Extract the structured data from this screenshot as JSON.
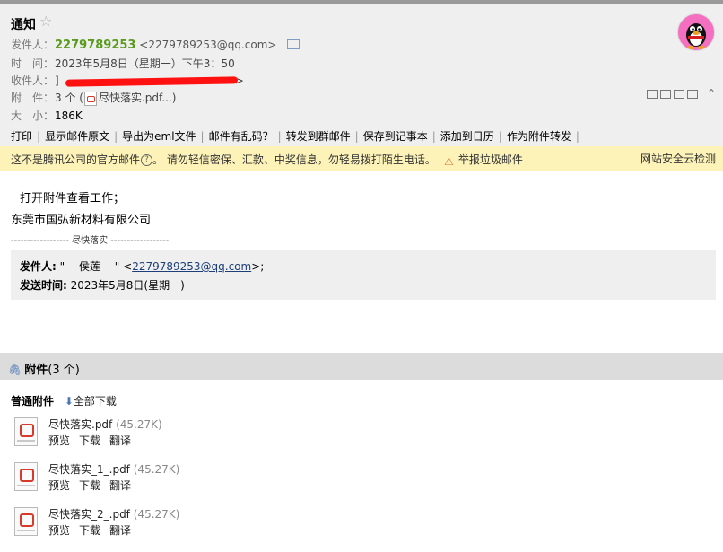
{
  "header": {
    "subject": "通知",
    "from_label": "发件人：",
    "from_name": "2279789253",
    "from_addr": "<2279789253@qq.com>",
    "time_label": "时　间：",
    "time_value": "2023年5月8日（星期一）下午3：50",
    "to_label": "收件人：",
    "to_prefix": "]",
    "to_suffix": ">",
    "attach_label": "附　件：",
    "attach_count": "3 个 (",
    "attach_file": "尽快落实.pdf...)",
    "size_label": "大　小：",
    "size_value": "186K"
  },
  "toolbar": [
    "打印",
    "显示邮件原文",
    "导出为eml文件",
    "邮件有乱码？",
    "转发到群邮件",
    "保存到记事本",
    "添加到日历",
    "作为附件转发"
  ],
  "toolbar_sep": "|",
  "warning": {
    "text": "这不是腾讯公司的官方邮件",
    "q": "?",
    "text2": "。 请勿轻信密保、汇款、中奖信息，勿轻易拨打陌生电话。",
    "report": "举报垃圾邮件",
    "security": "网站安全云检测"
  },
  "body": {
    "line1": "打开附件查看工作；",
    "line2": "东莞市国弘新材料有限公司",
    "divider": "------------------ 尽快落实 ------------------",
    "quote_from_label": "发件人:",
    "quote_from_name": "\"　 侯莲 　\" <",
    "quote_from_addr": "2279789253@qq.com",
    "quote_from_end": ">;",
    "quote_time_label": "发送时间:",
    "quote_time_value": " 2023年5月8日(星期一)"
  },
  "attachments": {
    "title": "附件",
    "count": "(3 个)",
    "section_label": "普通附件",
    "download_all": "全部下载",
    "files": [
      {
        "name": "尽快落实.pdf",
        "size": "(45.27K)"
      },
      {
        "name": "尽快落实_1_.pdf",
        "size": "(45.27K)"
      },
      {
        "name": "尽快落实_2_.pdf",
        "size": "(45.27K)"
      }
    ],
    "actions": [
      "预览",
      "下载",
      "翻译"
    ]
  },
  "colors": {
    "sender": "#5a9b1e",
    "warning_bg": "#fdf3b8",
    "header_bg": "#efefef",
    "redaction": "#ff1111"
  }
}
